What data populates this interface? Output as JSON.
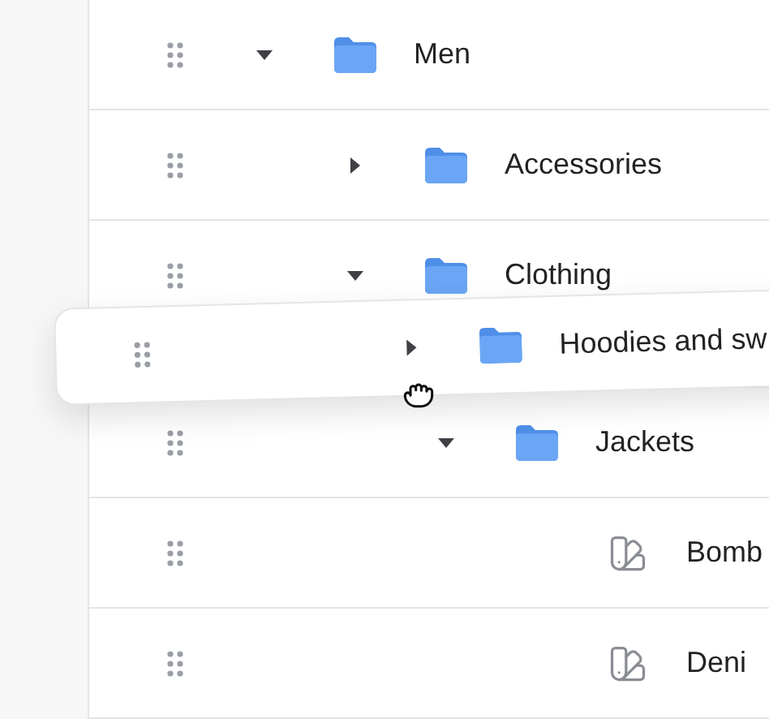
{
  "tree": [
    {
      "kind": "folder",
      "label": "Men",
      "expanded": true,
      "children": [
        {
          "kind": "folder",
          "label": "Accessories",
          "expanded": false
        },
        {
          "kind": "folder",
          "label": "Clothing",
          "expanded": true,
          "children": [
            {
              "kind": "drop-slot"
            },
            {
              "kind": "folder",
              "label": "Jackets",
              "expanded": true,
              "children": [
                {
                  "kind": "item",
                  "label": "Bomb"
                },
                {
                  "kind": "item",
                  "label": "Deni"
                }
              ]
            }
          ]
        }
      ]
    }
  ],
  "drag_preview": {
    "kind": "folder",
    "label": "Hoodies and sw",
    "expanded": false
  }
}
